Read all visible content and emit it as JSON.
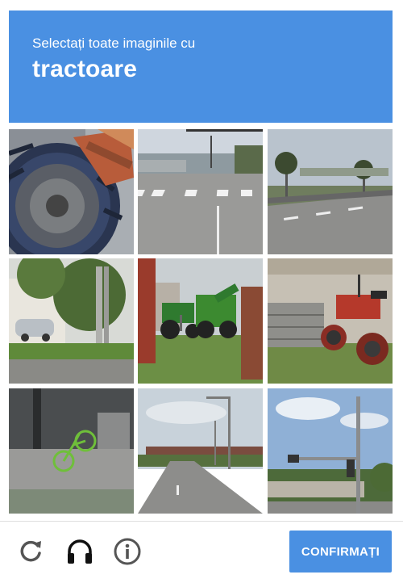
{
  "header": {
    "instruction": "Selectați toate imaginile cu",
    "target": "tractoare"
  },
  "grid": {
    "tiles": [
      {
        "subject": "tractor-wheel-closeup"
      },
      {
        "subject": "crosswalk-street"
      },
      {
        "subject": "palm-tree-road"
      },
      {
        "subject": "trees-and-pole"
      },
      {
        "subject": "green-tractors-barn"
      },
      {
        "subject": "red-tractor"
      },
      {
        "subject": "bicycle-by-building"
      },
      {
        "subject": "highway-overpass"
      },
      {
        "subject": "traffic-light-street"
      }
    ]
  },
  "footer": {
    "reload_icon": "reload-icon",
    "audio_icon": "headphones-icon",
    "info_icon": "info-icon",
    "confirm_label": "CONFIRMAȚI"
  },
  "colors": {
    "accent": "#4a90e2",
    "icon_gray": "#555555"
  }
}
